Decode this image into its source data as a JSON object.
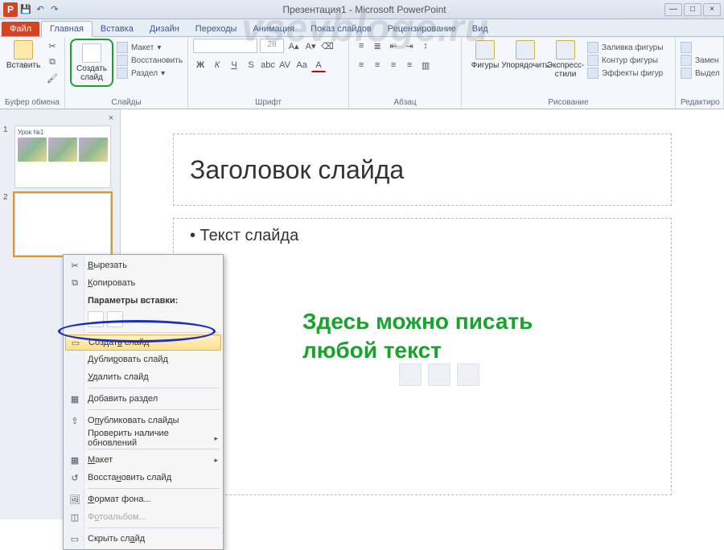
{
  "titlebar": {
    "title": "Презентация1 - Microsoft PowerPoint"
  },
  "tabs": {
    "file": "Файл",
    "home": "Главная",
    "insert": "Вставка",
    "design": "Дизайн",
    "transitions": "Переходы",
    "animations": "Анимация",
    "slideshow": "Показ слайдов",
    "review": "Рецензирование",
    "view": "Вид"
  },
  "ribbon": {
    "clipboard": {
      "paste": "Вставить",
      "label": "Буфер обмена"
    },
    "slides": {
      "new_slide": "Создать слайд",
      "layout": "Макет",
      "reset": "Восстановить",
      "section": "Раздел",
      "label": "Слайды"
    },
    "font": {
      "size": "28",
      "label": "Шрифт"
    },
    "paragraph": {
      "label": "Абзац"
    },
    "drawing": {
      "shapes": "Фигуры",
      "arrange": "Упорядочить",
      "quick_styles": "Экспресс-стили",
      "fill": "Заливка фигуры",
      "outline": "Контур фигуры",
      "effects": "Эффекты фигур",
      "label": "Рисование"
    },
    "editing": {
      "replace": "Замен",
      "select": "Выдел",
      "label": "Редактиро"
    }
  },
  "thumbs": {
    "slide1_title": "Урок №1"
  },
  "slide": {
    "title": "Заголовок слайда",
    "bullet": "• Текст слайда",
    "overlay_line1": "Здесь можно писать",
    "overlay_line2": "любой текст"
  },
  "ctx": {
    "cut": "Вырезать",
    "copy": "Копировать",
    "paste_header": "Параметры вставки:",
    "new_slide": "Создать слайд",
    "duplicate": "Дублировать слайд",
    "delete": "Удалить слайд",
    "add_section": "Добавить раздел",
    "publish": "Опубликовать слайды",
    "check_updates": "Проверить наличие обновлений",
    "layout": "Макет",
    "reset": "Восстановить слайд",
    "format_bg": "Формат фона...",
    "photo_album": "Фотоальбом...",
    "hide": "Скрыть слайд"
  },
  "watermark": "vsevbloge.ru"
}
